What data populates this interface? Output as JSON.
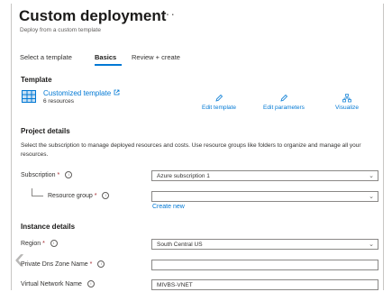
{
  "header": {
    "title": "Custom deployment",
    "subtitle": "Deploy from a custom template",
    "more_icon": "ellipsis-icon"
  },
  "tabs": [
    {
      "label": "Select a template",
      "active": false
    },
    {
      "label": "Basics",
      "active": true
    },
    {
      "label": "Review + create",
      "active": false
    }
  ],
  "template": {
    "heading": "Template",
    "name": "Customized template",
    "resources": "6 resources",
    "icon": "template-grid-icon",
    "actions": {
      "edit_template": "Edit template",
      "edit_parameters": "Edit parameters",
      "visualize": "Visualize"
    }
  },
  "project": {
    "heading": "Project details",
    "description": "Select the subscription to manage deployed resources and costs. Use resource groups like folders to organize and manage all your resources.",
    "subscription_label": "Subscription",
    "subscription_value": "Azure subscription 1",
    "resource_group_label": "Resource group",
    "resource_group_value": "",
    "create_new": "Create new"
  },
  "instance": {
    "heading": "Instance details",
    "region_label": "Region",
    "region_value": "South Central US",
    "dns_label": "Private Dns Zone Name",
    "dns_value": "",
    "vnet_label": "Virtual Network Name",
    "vnet_value": "MIVBS-VNET"
  },
  "accent_color": "#0078d4",
  "required_color": "#a4262c"
}
